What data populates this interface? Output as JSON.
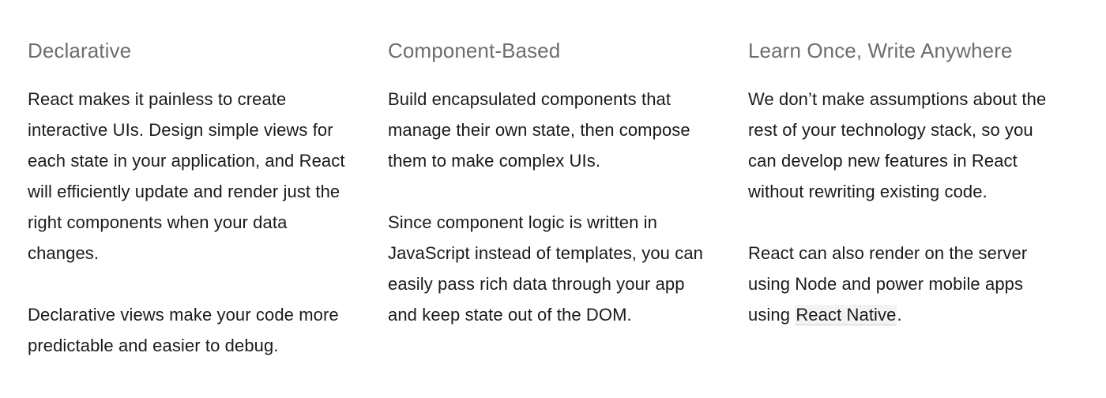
{
  "features": {
    "declarative": {
      "title": "Declarative",
      "p1": "React makes it painless to create interactive UIs. Design simple views for each state in your application, and React will efficiently update and render just the right components when your data changes.",
      "p2": "Declarative views make your code more predictable and easier to debug."
    },
    "component_based": {
      "title": "Component-Based",
      "p1": "Build encapsulated components that manage their own state, then compose them to make complex UIs.",
      "p2": "Since component logic is written in JavaScript instead of templates, you can easily pass rich data through your app and keep state out of the DOM."
    },
    "learn_once": {
      "title": "Learn Once, Write Anywhere",
      "p1": "We don’t make assumptions about the rest of your technology stack, so you can develop new features in React without rewriting existing code.",
      "p2_prefix": "React can also render on the server using Node and power mobile apps using ",
      "p2_link": "React Native",
      "p2_suffix": "."
    }
  }
}
